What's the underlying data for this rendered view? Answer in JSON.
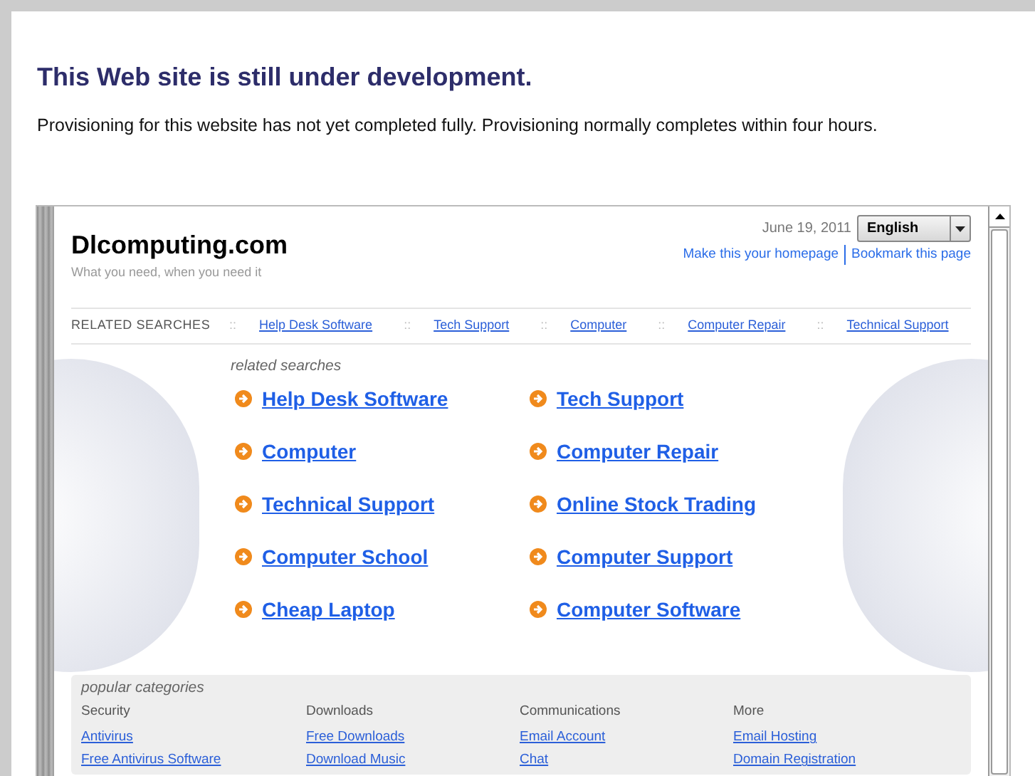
{
  "notice": {
    "heading": "This Web site is still under development.",
    "text": "Provisioning for this website has not yet completed fully. Provisioning normally completes within four hours."
  },
  "site": {
    "name": "Dlcomputing.com",
    "tagline": "What you need, when you need it",
    "date": "June 19, 2011",
    "language": "English",
    "links": [
      "Make this your homepage",
      "Bookmark this page"
    ]
  },
  "related_bar": {
    "label": "RELATED SEARCHES",
    "links": [
      {
        "separator": "::",
        "label": "Help Desk Software"
      },
      {
        "separator": "::",
        "label": "Tech Support"
      },
      {
        "separator": "::",
        "label": "Computer"
      },
      {
        "separator": "::",
        "label": "Computer Repair"
      },
      {
        "separator": "::",
        "label": "Technical Support"
      }
    ]
  },
  "related": {
    "title": "related searches",
    "items": [
      "Help Desk Software",
      "Tech Support",
      "Computer",
      "Computer Repair",
      "Technical Support",
      "Online Stock Trading",
      "Computer School",
      "Computer Support",
      "Cheap Laptop",
      "Computer Software"
    ]
  },
  "popular": {
    "title": "popular categories",
    "columns": [
      {
        "heading": "Security",
        "links": [
          "Antivirus",
          "Free Antivirus Software"
        ]
      },
      {
        "heading": "Downloads",
        "links": [
          "Free Downloads",
          "Download Music"
        ]
      },
      {
        "heading": "Communications",
        "links": [
          "Email Account",
          "Chat"
        ]
      },
      {
        "heading": "More",
        "links": [
          "Email Hosting",
          "Domain Registration"
        ]
      }
    ]
  }
}
